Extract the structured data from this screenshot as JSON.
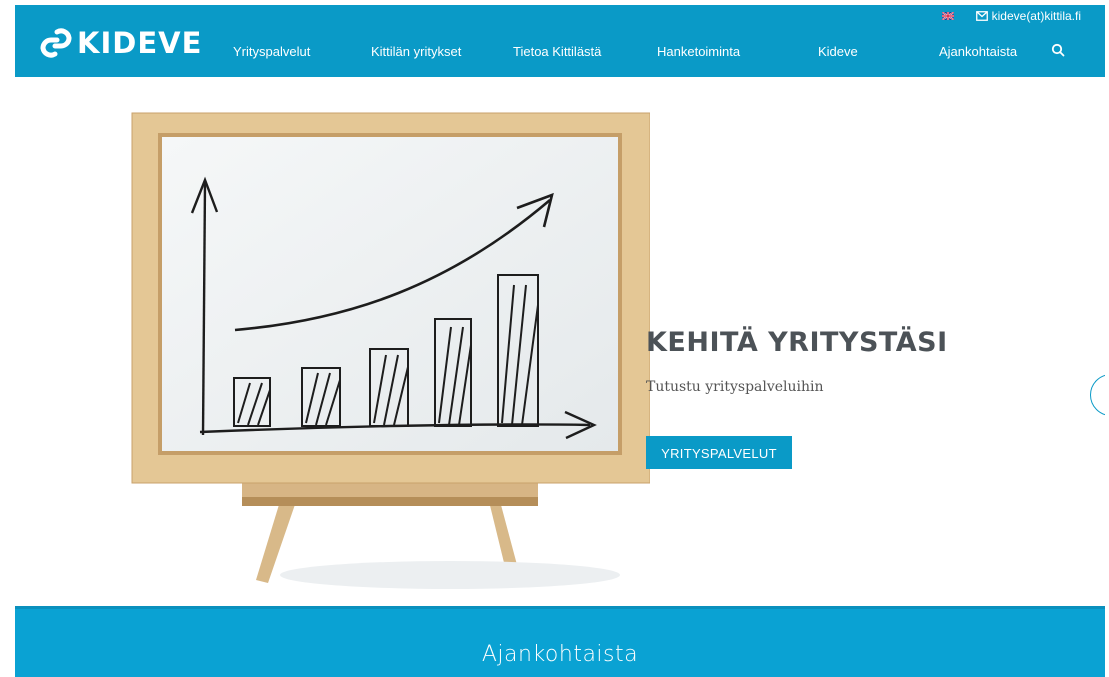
{
  "header": {
    "logo_text": "KIDEVE",
    "email_link": "kideve(at)kittila.fi",
    "nav_items": [
      {
        "label": "Yrityspalvelut"
      },
      {
        "label": "Kittilän yritykset"
      },
      {
        "label": "Tietoa Kittilästä"
      },
      {
        "label": "Hanketoiminta"
      },
      {
        "label": "Kideve"
      },
      {
        "label": "Ajankohtaista"
      }
    ],
    "icons": [
      "logo-icon",
      "flag-uk-icon",
      "mail-icon",
      "search-icon"
    ]
  },
  "hero": {
    "title": "KEHITÄ YRITYSTÄSI",
    "subtitle": "Tutustu yrityspalveluihin",
    "button_label": "YRITYSPALVELUT",
    "image": "whiteboard-growth-chart-illustration"
  },
  "section": {
    "title": "Ajankohtaista"
  },
  "colors": {
    "brand": "#0a9ac7",
    "section_bg": "#0aa2d3",
    "title_text": "#4c5257"
  }
}
